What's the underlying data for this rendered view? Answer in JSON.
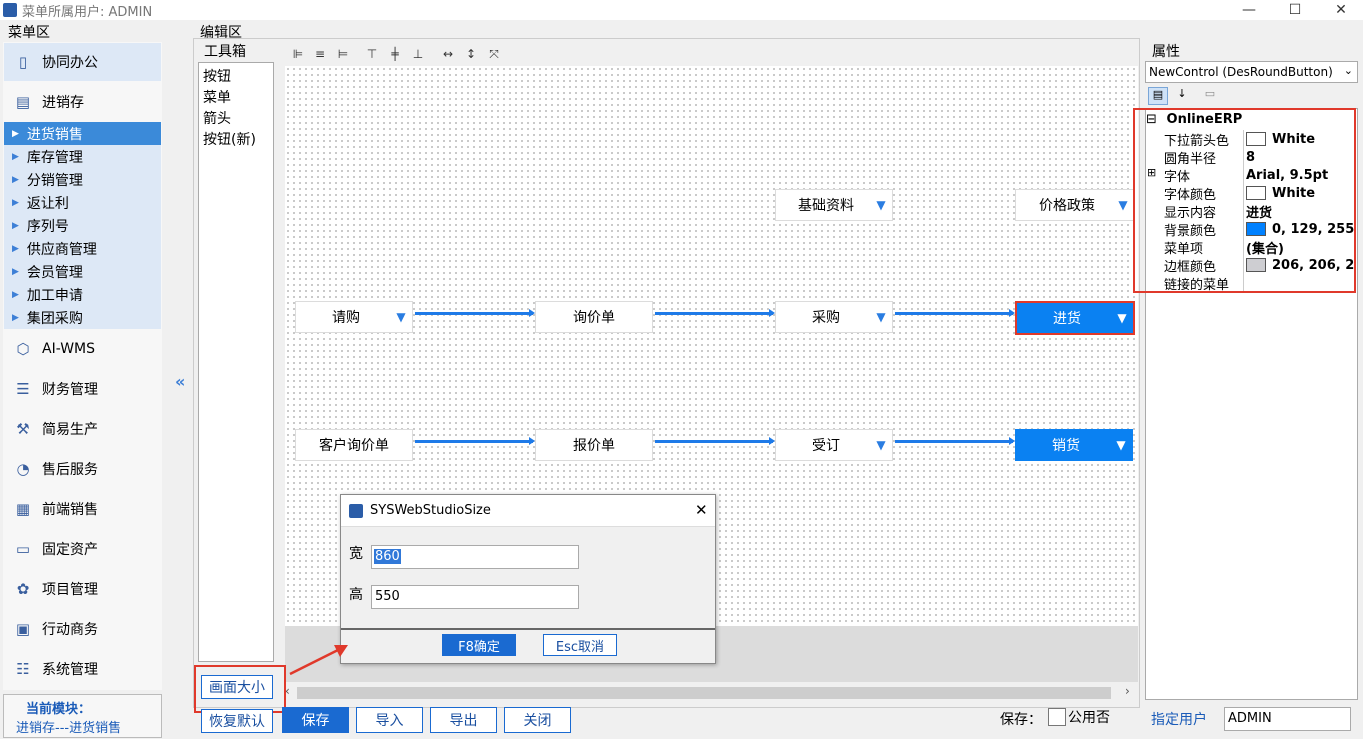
{
  "window": {
    "title": "菜单所属用户: ADMIN",
    "min_icon": "minimize-icon",
    "max_icon": "maximize-icon",
    "close_icon": "close-icon"
  },
  "menu_area": {
    "label": "菜单区",
    "items": [
      {
        "label": "协同办公",
        "icon": "tablet-icon"
      },
      {
        "label": "进销存",
        "icon": "book-icon"
      }
    ],
    "subitems": [
      {
        "label": "进货销售",
        "selected": true
      },
      {
        "label": "库存管理"
      },
      {
        "label": "分销管理"
      },
      {
        "label": "返让利"
      },
      {
        "label": "序列号"
      },
      {
        "label": "供应商管理"
      },
      {
        "label": "会员管理"
      },
      {
        "label": "加工申请"
      },
      {
        "label": "集团采购"
      }
    ],
    "items2": [
      {
        "label": "AI-WMS",
        "icon": "cube-icon"
      },
      {
        "label": "财务管理",
        "icon": "list-icon"
      },
      {
        "label": "简易生产",
        "icon": "factory-icon"
      },
      {
        "label": "售后服务",
        "icon": "piechart-icon"
      },
      {
        "label": "前端销售",
        "icon": "store-icon"
      },
      {
        "label": "固定资产",
        "icon": "car-icon"
      },
      {
        "label": "项目管理",
        "icon": "gear-icon"
      },
      {
        "label": "行动商务",
        "icon": "briefcase-icon"
      },
      {
        "label": "系统管理",
        "icon": "sliders-icon"
      }
    ],
    "current_module_label": "当前模块：",
    "current_module_value": "进销存---进货销售"
  },
  "edit_area": {
    "label": "编辑区"
  },
  "toolbox": {
    "label": "工具箱",
    "items": [
      "按钮",
      "菜单",
      "箭头",
      "按钮(新)"
    ]
  },
  "canvas": {
    "nodes": {
      "basic": "基础资料",
      "price": "价格政策",
      "request": "请购",
      "inquiry": "询价单",
      "purchase": "采购",
      "stockin": "进货",
      "cust_inquiry": "客户询价单",
      "quote": "报价单",
      "order": "受订",
      "sales": "销货"
    },
    "dropdown_glyph": "▼"
  },
  "dialog": {
    "title": "SYSWebStudioSize",
    "width_label": "宽",
    "width_value": "860",
    "height_label": "高",
    "height_value": "550",
    "ok": "F8确定",
    "cancel": "Esc取消"
  },
  "bottom": {
    "canvas_size": "画面大小",
    "restore": "恢复默认",
    "save": "保存",
    "import": "导入",
    "export": "导出",
    "close": "关闭",
    "save_label": "保存：",
    "public_label": "公用否",
    "assign_user_label": "指定用户",
    "assign_user_value": "ADMIN"
  },
  "properties": {
    "label": "属性",
    "object": "NewControl (DesRoundButton)",
    "group": "OnlineERP",
    "rows": [
      {
        "name": "下拉箭头色",
        "value": "White",
        "color": "#ffffff"
      },
      {
        "name": "圆角半径",
        "value": "8"
      },
      {
        "name": "字体",
        "value": "Arial, 9.5pt",
        "expand": true
      },
      {
        "name": "字体颜色",
        "value": "White",
        "color": "#ffffff"
      },
      {
        "name": "显示内容",
        "value": "进货"
      },
      {
        "name": "背景颜色",
        "value": "0, 129, 255",
        "color": "#0081ff"
      },
      {
        "name": "菜单项",
        "value": "(集合)"
      },
      {
        "name": "边框颜色",
        "value": "206, 206, 210",
        "color": "#ceced2"
      },
      {
        "name": "链接的菜单",
        "value": ""
      }
    ]
  },
  "colors": {
    "accent": "#1a6ad1",
    "node_blue": "#0a81f2",
    "highlight_red": "#e0392b"
  }
}
